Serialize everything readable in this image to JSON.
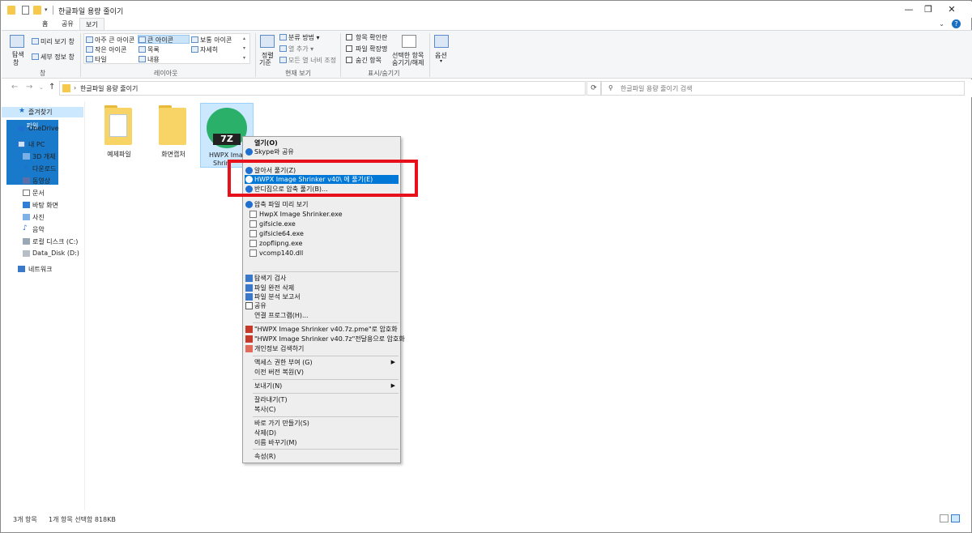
{
  "window": {
    "title": "한글파일 용량 줄이기"
  },
  "ribbon_tabs": [
    "파일",
    "홈",
    "공유",
    "보기"
  ],
  "ribbon": {
    "nav_pane": {
      "label_line1": "탐색",
      "label_line2": "창"
    },
    "preview_pane": "미리 보기 창",
    "details_pane": "세부 정보 창",
    "group_pane": "창",
    "layout": {
      "items": [
        "아주 큰 아이콘",
        "큰 아이콘",
        "보통 아이콘",
        "작은 아이콘",
        "목록",
        "자세히",
        "타일",
        "내용"
      ],
      "selected": "큰 아이콘",
      "group_label": "레이아웃"
    },
    "current_view": {
      "sort_line1": "정렬",
      "sort_line2": "기준",
      "group_by": "분류 방법",
      "add_column": "열 추가",
      "fit_columns": "모든 열 너비 조정",
      "group_label": "현재 보기"
    },
    "show_hide": {
      "item_checkbox": "항목 확인란",
      "file_ext": "파일 확장명",
      "hidden_items": "숨긴 항목",
      "hide_selected_line1": "선택한 항목",
      "hide_selected_line2": "숨기기/해제",
      "group_label": "표시/숨기기"
    },
    "options": "옵션"
  },
  "address": {
    "path": "한글파일 용량 줄이기",
    "search_placeholder": "한글파일 용량 줄이기 검색"
  },
  "nav_pane": {
    "items": [
      "즐겨찾기",
      "OneDrive",
      "내 PC",
      "3D 개체",
      "다운로드",
      "동영상",
      "문서",
      "바탕 화면",
      "사진",
      "음악",
      "로컬 디스크 (C:)",
      "Data_Disk (D:)",
      "네트워크"
    ]
  },
  "files": [
    {
      "name": "예제파일"
    },
    {
      "name": "화면캡처"
    },
    {
      "name_line1": "HWPX Imag",
      "name_line2": "Shrin",
      "badge": "7Z"
    }
  ],
  "context_menu": {
    "items": [
      "열기(O)",
      "Skype와 공유",
      "알아서 풀기(Z)",
      "HWPX Image Shrinker v40\\ 에 풀기(E)",
      "반디집으로 압축 풀기(B)...",
      "압축 파일 미리 보기",
      "HwpX Image Shrinker.exe",
      "gifsicle.exe",
      "gifsicle64.exe",
      "zopflipng.exe",
      "vcomp140.dll",
      "탐색기 검사",
      "파일 완전 삭제",
      "파일 분석 보고서",
      "공유",
      "연결 프로그램(H)...",
      "\"HWPX Image Shrinker v40.7z.pme\"로 암호화",
      "\"HWPX Image Shrinker v40.7z\"전달용으로 암호화",
      "개인정보 검색하기",
      "액세스 권한 부여 (G)",
      "이전 버전 복원(V)",
      "보내기(N)",
      "잘라내기(T)",
      "복사(C)",
      "바로 가기 만들기(S)",
      "삭제(D)",
      "이름 바꾸기(M)",
      "속성(R)"
    ],
    "highlighted": "HWPX Image Shrinker v40\\ 에 풀기(E)"
  },
  "status": {
    "item_count": "3개 항목",
    "selection": "1개 항목 선택함 818KB"
  },
  "colors": {
    "accent": "#0078d7",
    "file_tab": "#1979ca",
    "highlight_box": "#e8101a",
    "app_icon": "#2bb06a"
  }
}
